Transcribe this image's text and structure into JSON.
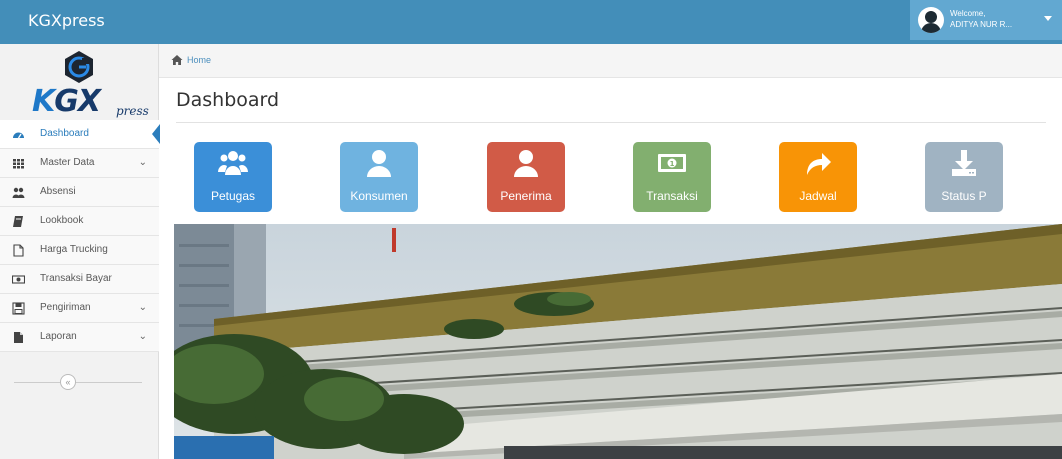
{
  "app": {
    "brand": "KGXpress"
  },
  "user": {
    "welcome": "Welcome,",
    "name": "ADITYA NUR R..."
  },
  "logo": {
    "k": "K",
    "gx": "GX",
    "sub": "press"
  },
  "sidebar": {
    "items": [
      {
        "label": "Dashboard",
        "icon": "dashboard-icon",
        "active": true
      },
      {
        "label": "Master Data",
        "icon": "grid-icon",
        "caret": "⌄"
      },
      {
        "label": "Absensi",
        "icon": "users-icon"
      },
      {
        "label": "Lookbook",
        "icon": "book-icon"
      },
      {
        "label": "Harga Trucking",
        "icon": "file-icon"
      },
      {
        "label": "Transaksi Bayar",
        "icon": "money-icon"
      },
      {
        "label": "Pengiriman",
        "icon": "floppy-icon",
        "caret": "⌄"
      },
      {
        "label": "Laporan",
        "icon": "document-icon",
        "caret": "⌄"
      }
    ],
    "collapse": "«"
  },
  "breadcrumb": {
    "home": "Home"
  },
  "page": {
    "title": "Dashboard"
  },
  "tiles": [
    {
      "label": "Petugas",
      "color": "#3b8fd8",
      "icon": "group-icon"
    },
    {
      "label": "Konsumen",
      "color": "#6fb3e0",
      "icon": "user-icon"
    },
    {
      "label": "Penerima",
      "color": "#d15b47",
      "icon": "user-icon"
    },
    {
      "label": "Transaksi",
      "color": "#82af6f",
      "icon": "money-icon"
    },
    {
      "label": "Jadwal",
      "color": "#f89406",
      "icon": "share-icon"
    },
    {
      "label": "Status P",
      "color": "#a0b3c2",
      "icon": "download-icon"
    }
  ],
  "colors": {
    "navbar": "#438eb9",
    "accent": "#2b7dbc"
  }
}
